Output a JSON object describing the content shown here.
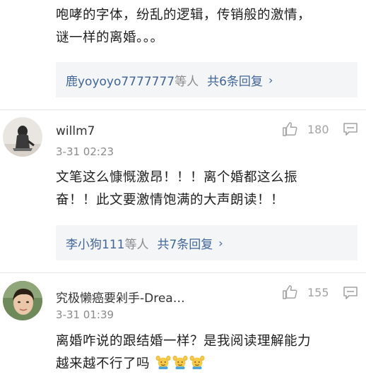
{
  "comment0": {
    "text_line1": "咆哮的字体，纷乱的逻辑，传销般的激情，",
    "text_line2": "谜一样的离婚。。。",
    "reply_names": "鹿yoyoyo7777777",
    "reply_suffix": "等人",
    "reply_count": "共6条回复",
    "chevron": "›"
  },
  "comment1": {
    "username": "willm7",
    "time": "3-31 02:23",
    "likes": "180",
    "text_line1": "文笔这么慷慨激昂！！！离个婚都这么振",
    "text_line2": "奋！！此文要激情饱满的大声朗读！！",
    "reply_names": "李小狗111",
    "reply_suffix": "等人",
    "reply_count": "共7条回复",
    "chevron": "›"
  },
  "comment2": {
    "username": "究极懒癌要剁手-Drea…",
    "time": "3-31 01:39",
    "likes": "155",
    "text_line1": "离婚咋说的跟结婚一样？是我阅读理解能力",
    "text_line2": "越来越不行了吗",
    "emojis": [
      "hands-up-emoji",
      "hands-up-emoji",
      "hands-up-emoji"
    ]
  },
  "icons": {
    "like": "thumbs-up-icon",
    "reply": "comment-bubble-icon"
  },
  "colors": {
    "link": "#406599",
    "meta": "#8a8a8a",
    "reply_bg": "#f4f5f6"
  }
}
